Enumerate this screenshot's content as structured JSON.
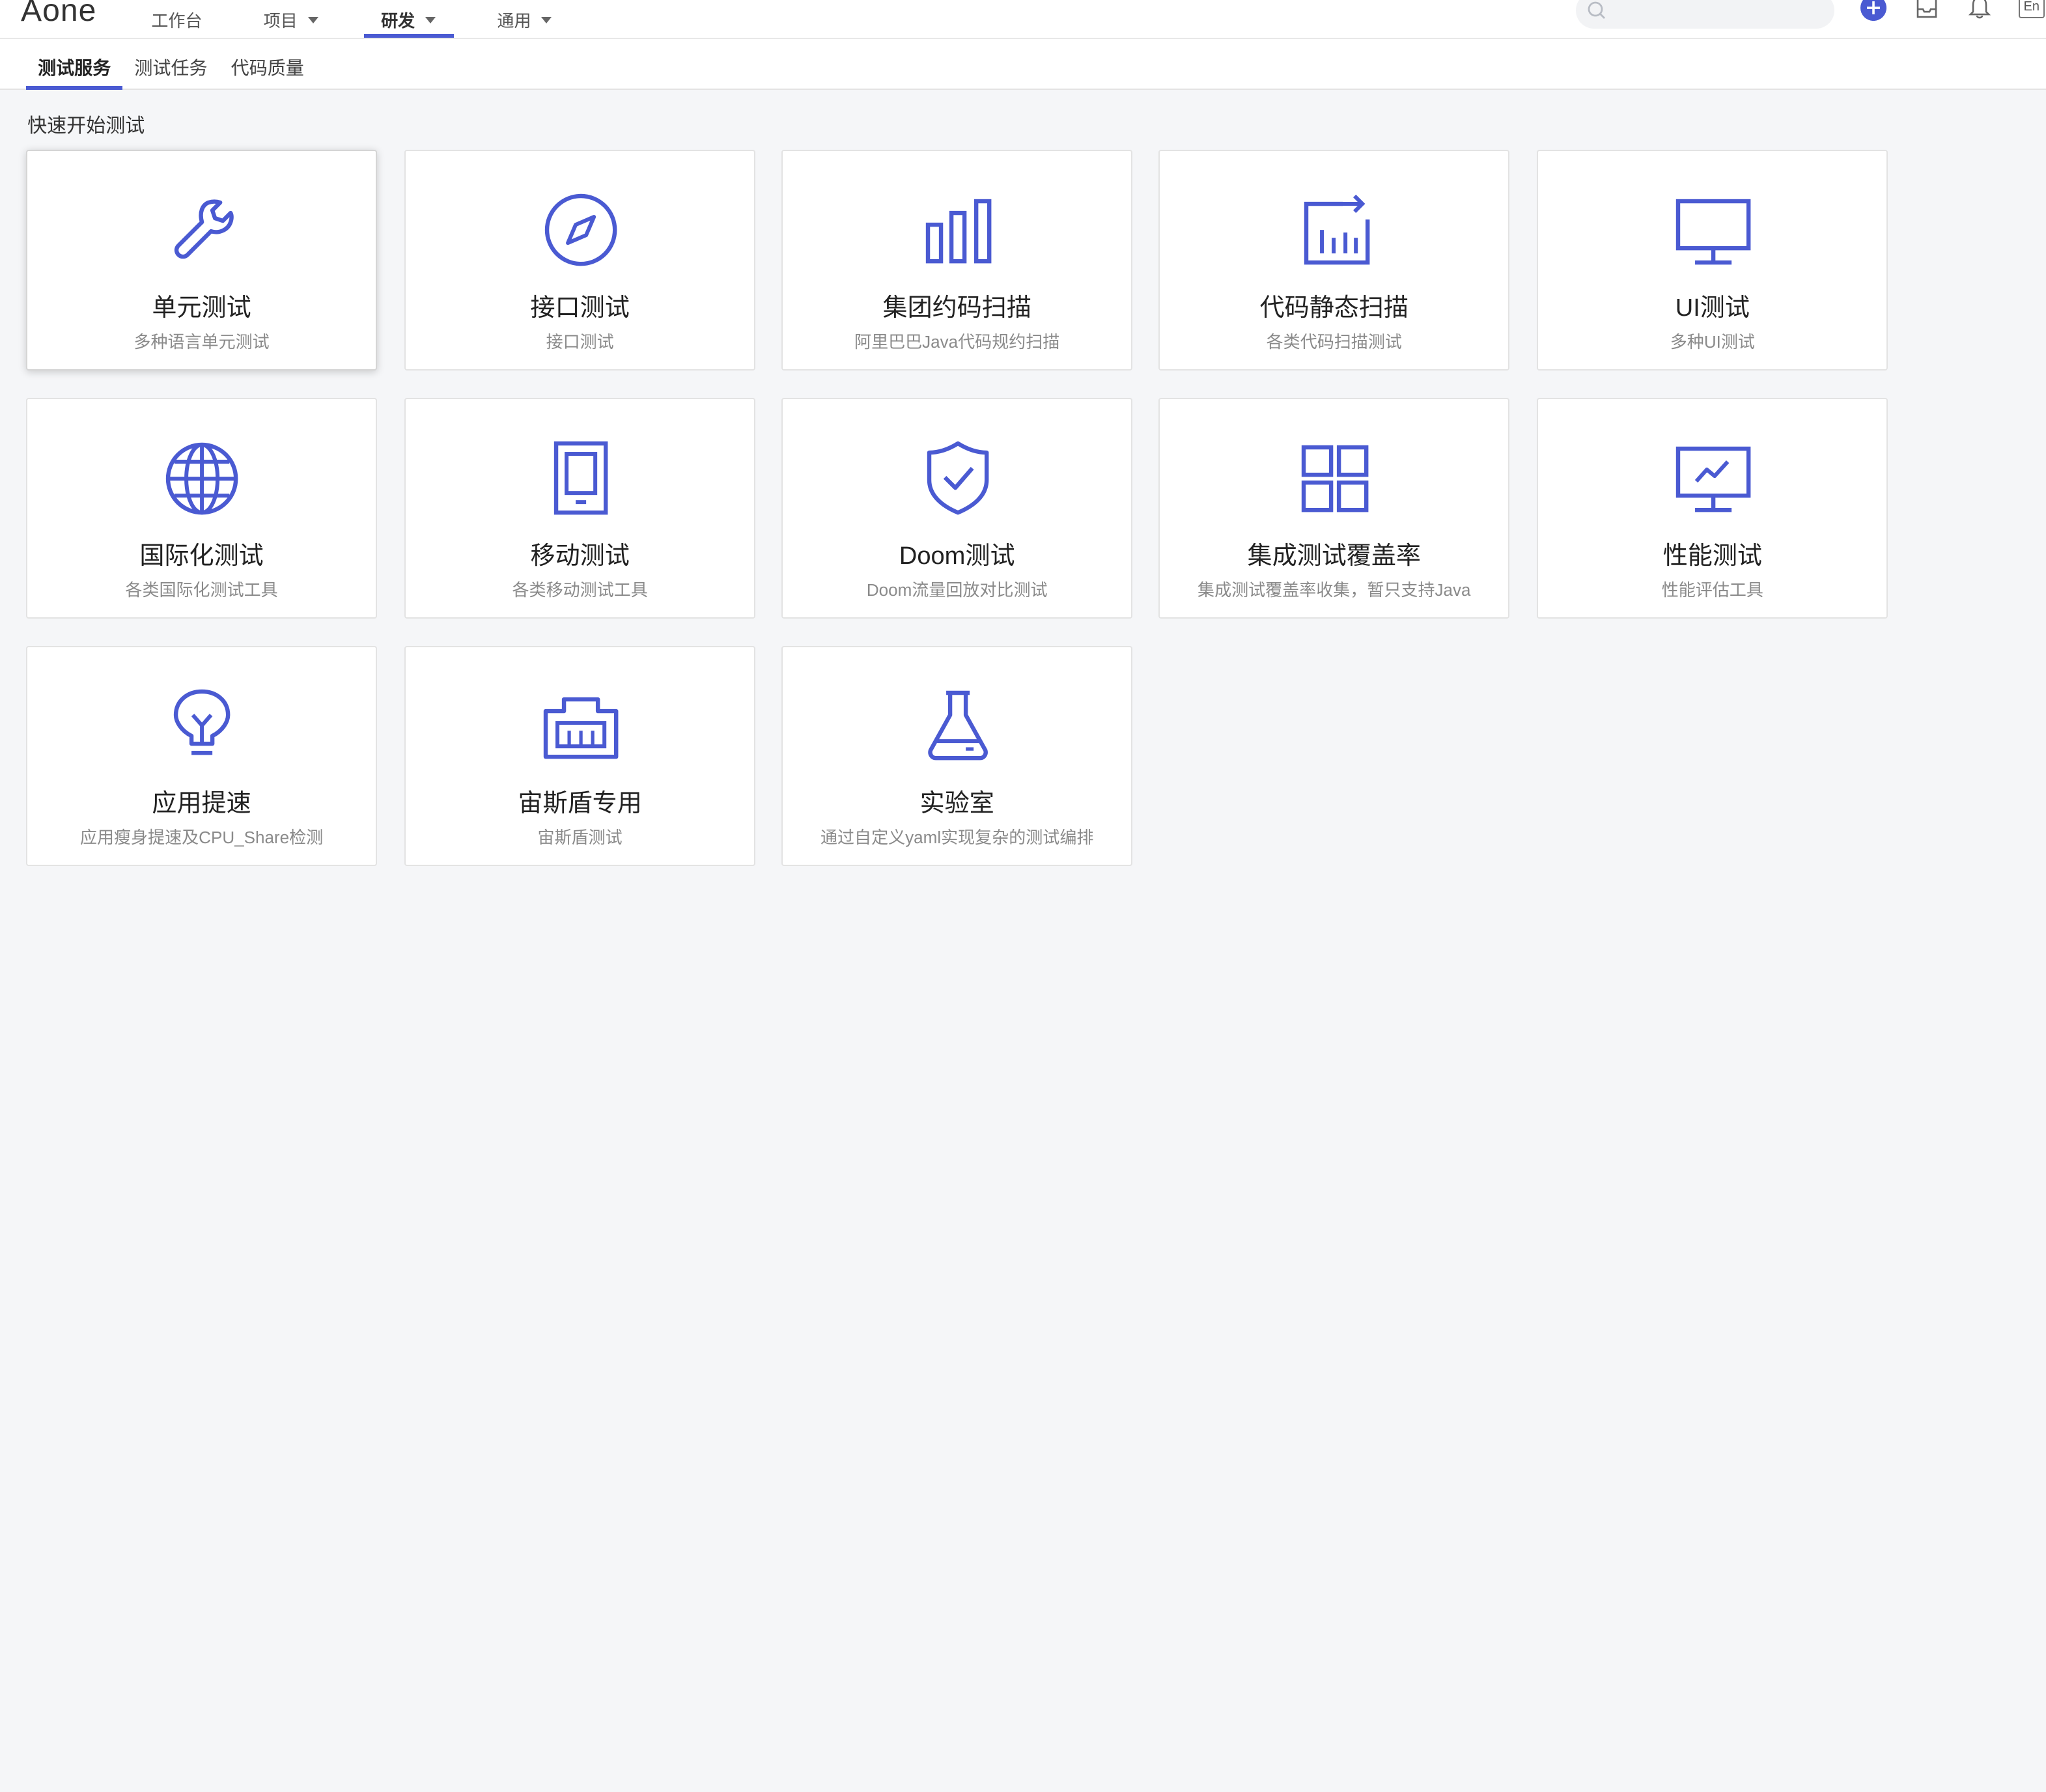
{
  "app": {
    "logo": "Aone"
  },
  "nav": {
    "workbench": "工作台",
    "project": "项目",
    "rd": "研发",
    "general": "通用"
  },
  "header_icons": [
    "search-icon",
    "add-icon",
    "inbox-icon",
    "bell-icon",
    "language-icon"
  ],
  "language_label": "En",
  "subtabs": [
    "测试服务",
    "测试任务",
    "代码质量"
  ],
  "section_title": "快速开始测试",
  "accent_color": "#4a5ad2",
  "cards": [
    {
      "title": "单元测试",
      "desc": "多种语言单元测试",
      "icon": "wrench-icon"
    },
    {
      "title": "接口测试",
      "desc": "接口测试",
      "icon": "compass-icon"
    },
    {
      "title": "集团约码扫描",
      "desc": "阿里巴巴Java代码规约扫描",
      "icon": "bar-chart-icon"
    },
    {
      "title": "代码静态扫描",
      "desc": "各类代码扫描测试",
      "icon": "chart-export-icon"
    },
    {
      "title": "UI测试",
      "desc": "多种UI测试",
      "icon": "monitor-icon"
    },
    {
      "title": "国际化测试",
      "desc": "各类国际化测试工具",
      "icon": "globe-icon"
    },
    {
      "title": "移动测试",
      "desc": "各类移动测试工具",
      "icon": "tablet-icon"
    },
    {
      "title": "Doom测试",
      "desc": "Doom流量回放对比测试",
      "icon": "shield-check-icon"
    },
    {
      "title": "集成测试覆盖率",
      "desc": "集成测试覆盖率收集，暂只支持Java",
      "icon": "grid-icon"
    },
    {
      "title": "性能测试",
      "desc": "性能评估工具",
      "icon": "monitor-chart-icon"
    },
    {
      "title": "应用提速",
      "desc": "应用瘦身提速及CPU_Share检测",
      "icon": "lightbulb-icon"
    },
    {
      "title": "宙斯盾专用",
      "desc": "宙斯盾测试",
      "icon": "ethernet-icon"
    },
    {
      "title": "实验室",
      "desc": "通过自定义yaml实现复杂的测试编排",
      "icon": "flask-icon"
    }
  ]
}
